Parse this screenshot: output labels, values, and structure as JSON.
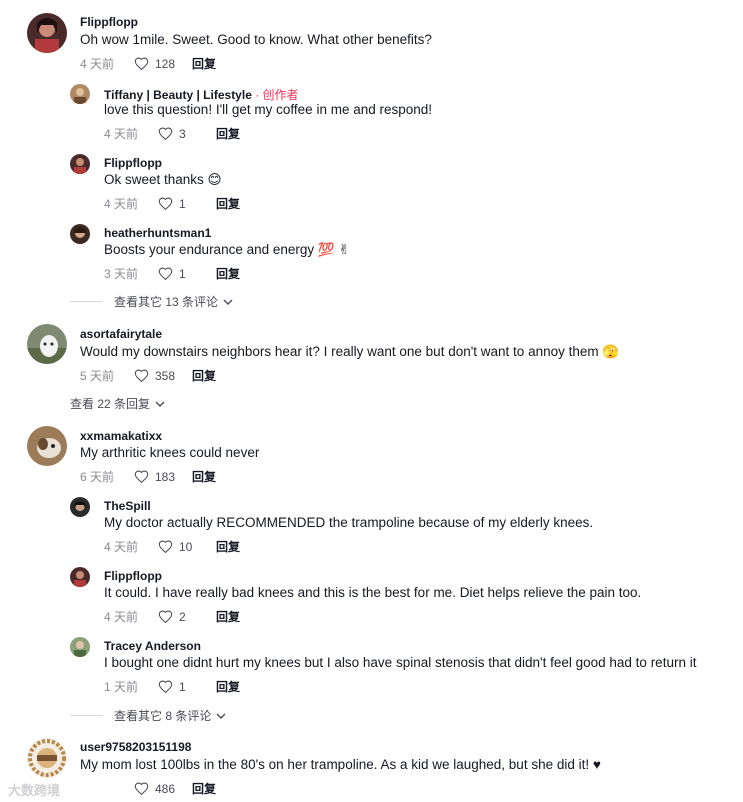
{
  "colors": {
    "creator": "#fe2c55",
    "muted": "#8a8b91",
    "text": "#161823"
  },
  "comments": [
    {
      "username": "Flippflopp",
      "text": "Oh wow 1mile. Sweet. Good to know. What other benefits?",
      "time": "4 天前",
      "likes": "128",
      "reply": "回复"
    },
    {
      "username": "Tiffany | Beauty | Lifestyle",
      "creator_tag": " · 创作者",
      "text": "love this question! I'll get my coffee in me and respond!",
      "time": "4 天前",
      "likes": "3",
      "reply": "回复"
    },
    {
      "username": "Flippflopp",
      "text": "Ok sweet thanks 😊",
      "time": "4 天前",
      "likes": "1",
      "reply": "回复"
    },
    {
      "username": "heatherhuntsman1",
      "text": "Boosts your endurance and energy 💯 ✌",
      "time": "3 天前",
      "likes": "1",
      "reply": "回复"
    },
    {
      "username": "asortafairytale",
      "text": "Would my downstairs neighbors hear it? I really want one but don't want to annoy them 🫣",
      "time": "5 天前",
      "likes": "358",
      "reply": "回复"
    },
    {
      "username": "xxmamakatixx",
      "text": "My arthritic knees could never",
      "time": "6 天前",
      "likes": "183",
      "reply": "回复"
    },
    {
      "username": "TheSpill",
      "text": "My doctor actually RECOMMENDED the trampoline because of my elderly knees.",
      "time": "4 天前",
      "likes": "10",
      "reply": "回复"
    },
    {
      "username": "Flippflopp",
      "text": "It could. I have really bad knees and this is the best for me. Diet helps relieve the pain too.",
      "time": "4 天前",
      "likes": "2",
      "reply": "回复"
    },
    {
      "username": "Tracey Anderson",
      "text": "I bought one didnt hurt my knees but I also have spinal stenosis that didn't feel good had to return it",
      "time": "1 天前",
      "likes": "1",
      "reply": "回复"
    },
    {
      "username": "user9758203151198",
      "text": "My mom lost 100lbs in the 80's on her trampoline. As a kid we laughed, but she did it! ♥",
      "time": "",
      "likes": "486",
      "reply": "回复"
    }
  ],
  "more_links": [
    "查看其它 13 条评论",
    "查看 22 条回复",
    "查看其它 8 条评论"
  ],
  "watermark": "大数跨境"
}
